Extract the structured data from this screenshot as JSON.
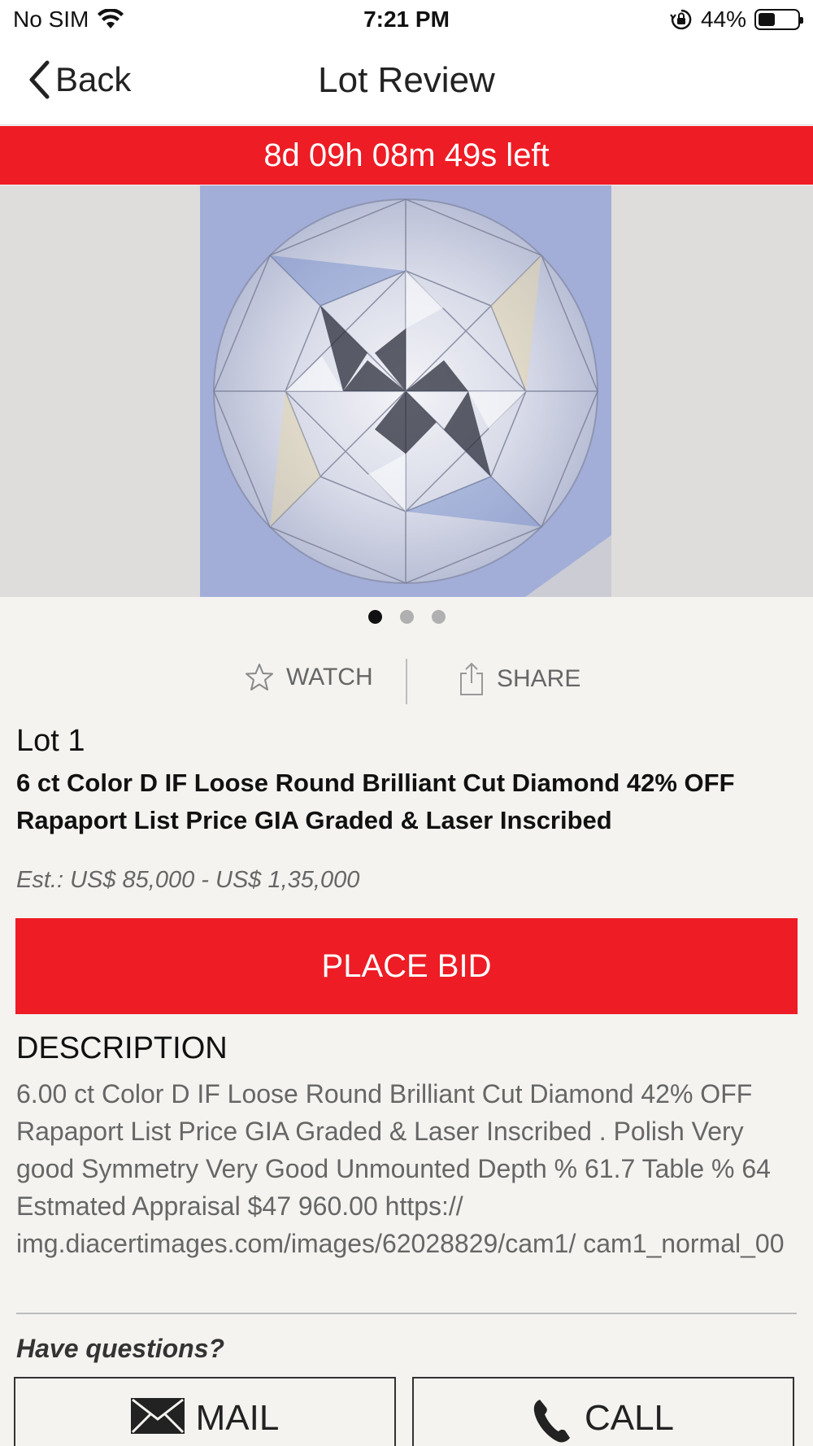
{
  "status_bar": {
    "carrier": "No SIM",
    "time": "7:21 PM",
    "battery_percent": "44%",
    "battery_level": 0.44
  },
  "nav": {
    "back_label": "Back",
    "title": "Lot Review"
  },
  "timer": {
    "text": "8d 09h 08m 49s left"
  },
  "carousel": {
    "page_count": 3,
    "active_index": 0
  },
  "actions": {
    "watch_label": "WATCH",
    "share_label": "SHARE"
  },
  "lot": {
    "number_label": "Lot 1",
    "title": "6 ct Color D IF Loose Round Brilliant Cut Diamond  42% OFF Rapaport List Price  GIA Graded  & Laser Inscribed",
    "estimate": "Est.: US$ 85,000 - US$ 1,35,000"
  },
  "place_bid_label": "PLACE BID",
  "description": {
    "heading": "DESCRIPTION",
    "text": "6.00 ct Color D IF Loose Round Brilliant Cut Diamond 42% OFF Rapaport List Price GIA Graded & Laser Inscribed . Polish Very good Symmetry Very Good Unmounted Depth % 61.7 Table % 64 Estmated Appraisal $47 960.00 https:// img.diacertimages.com/images/62028829/cam1/ cam1_normal_00"
  },
  "questions_label": "Have questions?",
  "contact": {
    "mail_label": "MAIL",
    "call_label": "CALL"
  },
  "colors": {
    "accent_red": "#ee1c25",
    "background": "#f4f3f0"
  }
}
